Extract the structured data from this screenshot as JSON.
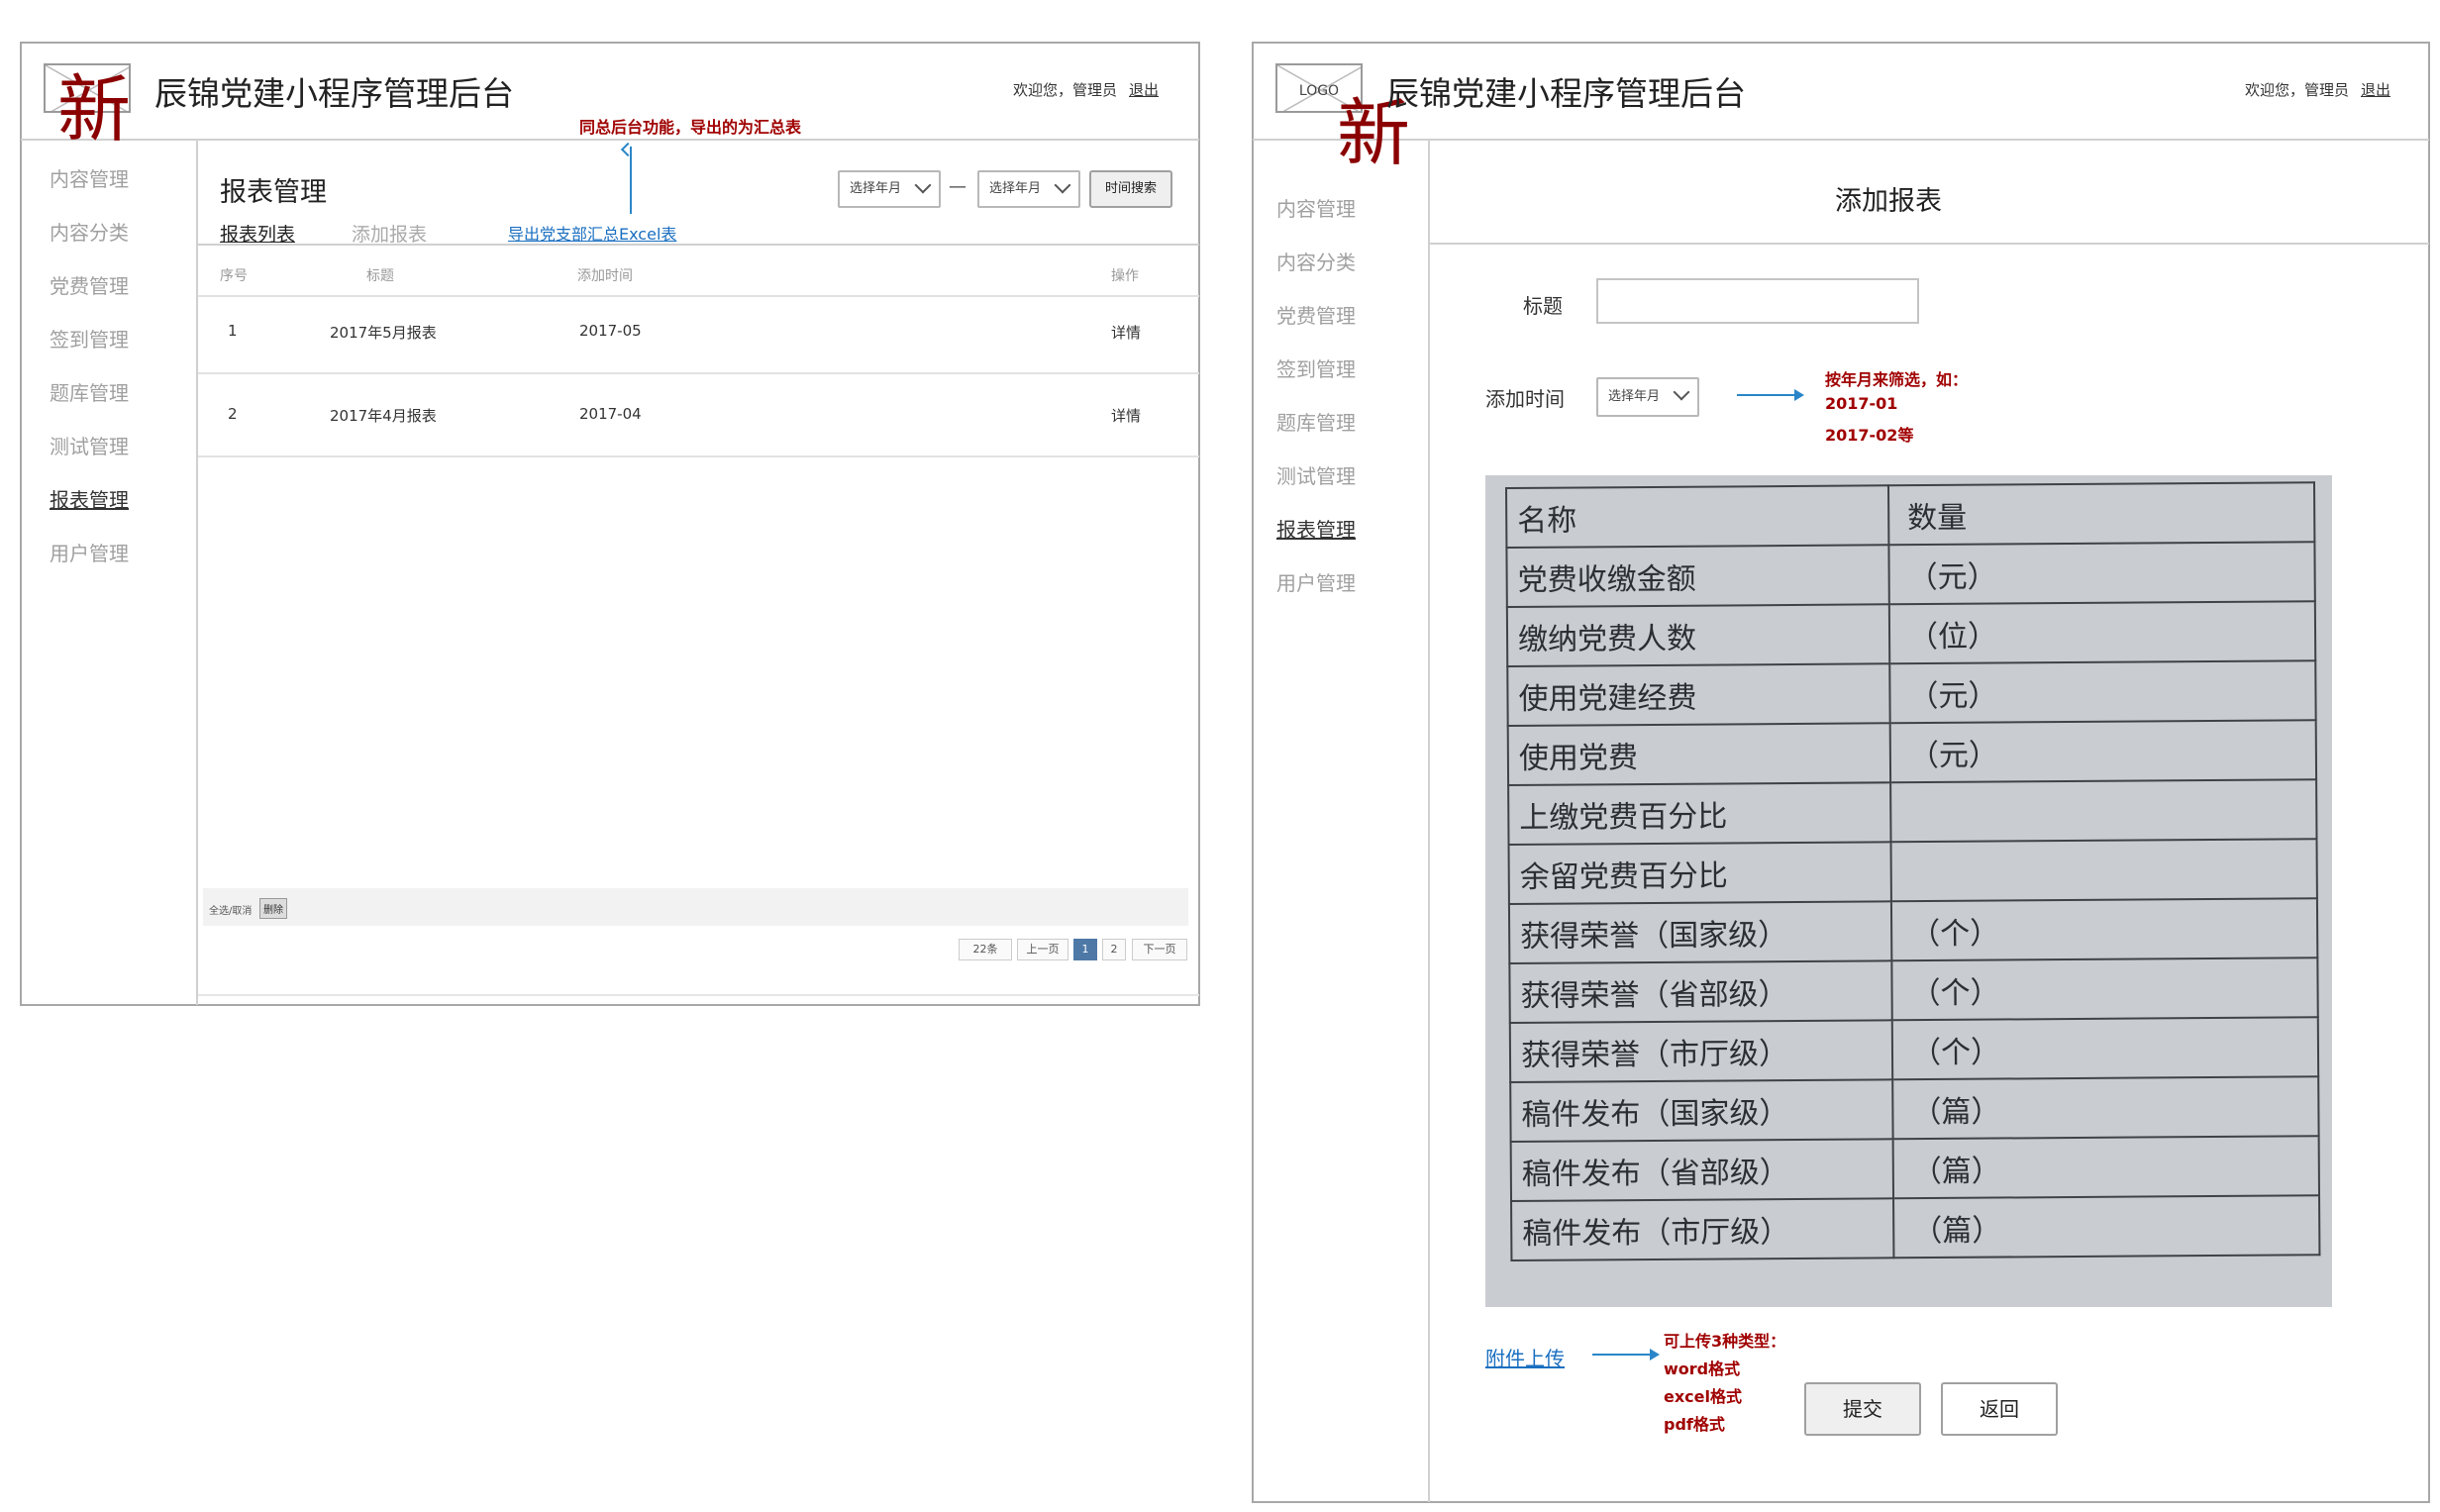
{
  "app_title": "辰锦党建小程序管理后台",
  "new_badge": "新",
  "welcome": "欢迎您，管理员",
  "logout": "退出",
  "logo_text": "LOGO",
  "nav": [
    "内容管理",
    "内容分类",
    "党费管理",
    "签到管理",
    "题库管理",
    "测试管理",
    "报表管理",
    "用户管理"
  ],
  "left": {
    "page_title": "报表管理",
    "tab_list": "报表列表",
    "tab_add": "添加报表",
    "export_link": "导出党支部汇总Excel表",
    "note_export": "同总后台功能，导出的为汇总表",
    "select_from": "选择年月",
    "dash": "—",
    "select_to": "选择年月",
    "search_button": "时间搜索",
    "columns": [
      "序号",
      "标题",
      "添加时间",
      "操作"
    ],
    "rows": [
      {
        "no": "1",
        "title": "2017年5月报表",
        "time": "2017-05",
        "action": "详情"
      },
      {
        "no": "2",
        "title": "2017年4月报表",
        "time": "2017-04",
        "action": "详情"
      }
    ],
    "select_all": "全选/取消",
    "delete": "删除",
    "pagination": {
      "total": "22条",
      "prev": "上一页",
      "pages": [
        "1",
        "2"
      ],
      "current": "1",
      "next": "下一页"
    }
  },
  "right": {
    "page_title": "添加报表",
    "title_label": "标题",
    "title_value": "",
    "time_label": "添加时间",
    "time_select": "选择年月",
    "note_filter": [
      "按年月来筛选，如：",
      "2017-01",
      "2017-02等"
    ],
    "attach_link": "附件上传",
    "note_upload": [
      "可上传3种类型：",
      "word格式",
      "excel格式",
      "pdf格式"
    ],
    "submit": "提交",
    "back": "返回",
    "photo_table": {
      "header": [
        "名称",
        "数量"
      ],
      "rows": [
        [
          "党费收缴金额",
          "（元）"
        ],
        [
          "缴纳党费人数",
          "（位）"
        ],
        [
          "使用党建经费",
          "（元）"
        ],
        [
          "使用党费",
          "（元）"
        ],
        [
          "上缴党费百分比",
          ""
        ],
        [
          "余留党费百分比",
          ""
        ],
        [
          "获得荣誉（国家级）",
          "（个）"
        ],
        [
          "获得荣誉（省部级）",
          "（个）"
        ],
        [
          "获得荣誉（市厅级）",
          "（个）"
        ],
        [
          "稿件发布（国家级）",
          "（篇）"
        ],
        [
          "稿件发布（省部级）",
          "（篇）"
        ],
        [
          "稿件发布（市厅级）",
          "（篇）"
        ]
      ]
    }
  }
}
